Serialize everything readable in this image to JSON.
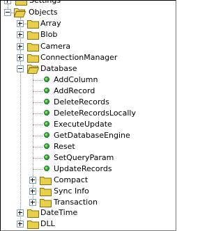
{
  "tree": {
    "top_partial_label": "Settings",
    "root_label": "Objects",
    "items": [
      {
        "label": "Array"
      },
      {
        "label": "Blob"
      },
      {
        "label": "Camera"
      },
      {
        "label": "ConnectionManager"
      },
      {
        "label": "Database"
      },
      {
        "label": "AddColumn"
      },
      {
        "label": "AddRecord"
      },
      {
        "label": "DeleteRecords"
      },
      {
        "label": "DeleteRecordsLocally"
      },
      {
        "label": "ExecuteUpdate"
      },
      {
        "label": "GetDatabaseEngine"
      },
      {
        "label": "Reset"
      },
      {
        "label": "SetQueryParam"
      },
      {
        "label": "UpdateRecords"
      },
      {
        "label": "Compact"
      },
      {
        "label": "Sync Info"
      },
      {
        "label": "Transaction"
      },
      {
        "label": "DateTime"
      },
      {
        "label": "DLL"
      }
    ]
  }
}
